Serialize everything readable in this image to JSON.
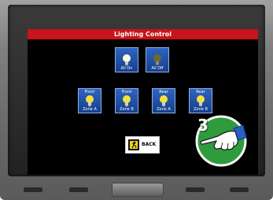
{
  "screen": {
    "title": "Lighting Control"
  },
  "master_buttons": [
    {
      "top": "",
      "label": "All On",
      "icon": "bulb-on-icon"
    },
    {
      "top": "",
      "label": "All Off",
      "icon": "bulb-off-icon"
    }
  ],
  "zone_buttons": [
    {
      "top": "Front",
      "label": "Zone A",
      "icon": "bulb-on-icon"
    },
    {
      "top": "Front",
      "label": "Zone B",
      "icon": "bulb-on-icon"
    },
    {
      "top": "Rear",
      "label": "Zone A",
      "icon": "bulb-on-icon"
    },
    {
      "top": "Rear",
      "label": "Zone B",
      "icon": "bulb-on-icon"
    }
  ],
  "back_button": {
    "label": "BACK",
    "icon": "exit-running-man-icon"
  },
  "step_badge": {
    "number": "3",
    "icon": "pointing-hand-icon"
  },
  "colors": {
    "title_bar": "#c8141a",
    "tile": "#2a5cb5",
    "bulb_on": "#f3e23a",
    "bulb_off": "#6e6a2a",
    "badge": "#2e9b3d"
  }
}
